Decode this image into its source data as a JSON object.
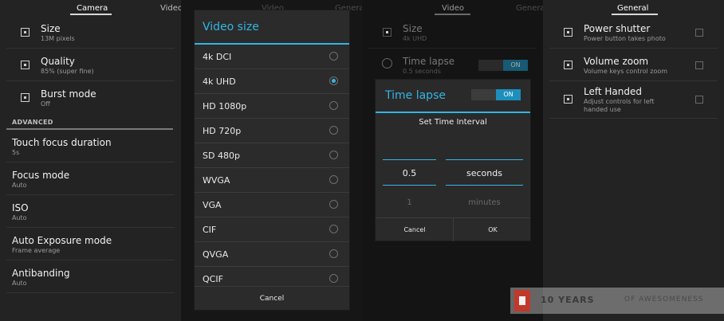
{
  "camera_panel": {
    "tabs": [
      "Camera",
      "VideoCamera"
    ],
    "items": [
      {
        "title": "Size",
        "summary": "13M pixels",
        "icon": "size-icon"
      },
      {
        "title": "Quality",
        "summary": "85% (super fine)",
        "icon": "quality-icon"
      },
      {
        "title": "Burst mode",
        "summary": "Off",
        "icon": "burst-icon"
      }
    ],
    "section": "ADVANCED",
    "advanced": [
      {
        "title": "Touch focus duration",
        "summary": "5s"
      },
      {
        "title": "Focus mode",
        "summary": "Auto"
      },
      {
        "title": "ISO",
        "summary": "Auto"
      },
      {
        "title": "Auto Exposure mode",
        "summary": "Frame average"
      },
      {
        "title": "Antibanding",
        "summary": "Auto"
      }
    ]
  },
  "video_size_panel": {
    "tabs": [
      "Video",
      "GeneralCamera"
    ],
    "dialog": {
      "title": "Video size",
      "options": [
        "4k DCI",
        "4k UHD",
        "HD 1080p",
        "HD 720p",
        "SD 480p",
        "WVGA",
        "VGA",
        "CIF",
        "QVGA",
        "QCIF"
      ],
      "selected": "4k UHD",
      "cancel": "Cancel"
    }
  },
  "time_lapse_panel": {
    "tabs": [
      "Video",
      "GeneralVideo"
    ],
    "background": [
      {
        "title": "Size",
        "summary": "4k UHD"
      },
      {
        "title": "Time lapse",
        "summary": "0.5 seconds",
        "toggle": "ON"
      }
    ],
    "dialog": {
      "title": "Time lapse",
      "toggle": "ON",
      "subtitle": "Set Time Interval",
      "value_selected": "0.5",
      "value_next": "1",
      "unit_selected": "seconds",
      "unit_next": "minutes",
      "cancel": "Cancel",
      "ok": "OK"
    }
  },
  "general_panel": {
    "tabs": [
      "General"
    ],
    "items": [
      {
        "title": "Power shutter",
        "summary": "Power button takes photo",
        "checked": false
      },
      {
        "title": "Volume zoom",
        "summary": "Volume keys control zoom",
        "checked": false
      },
      {
        "title": "Left Handed",
        "summary": "Adjust controls for left handed use",
        "checked": false
      }
    ]
  },
  "watermark": {
    "bold": "10 YEARS",
    "rest": "OF AWESOMENESS"
  },
  "colors": {
    "accent": "#33b5e5",
    "toggle_on": "#1c8fbd",
    "badge": "#c0392b"
  }
}
